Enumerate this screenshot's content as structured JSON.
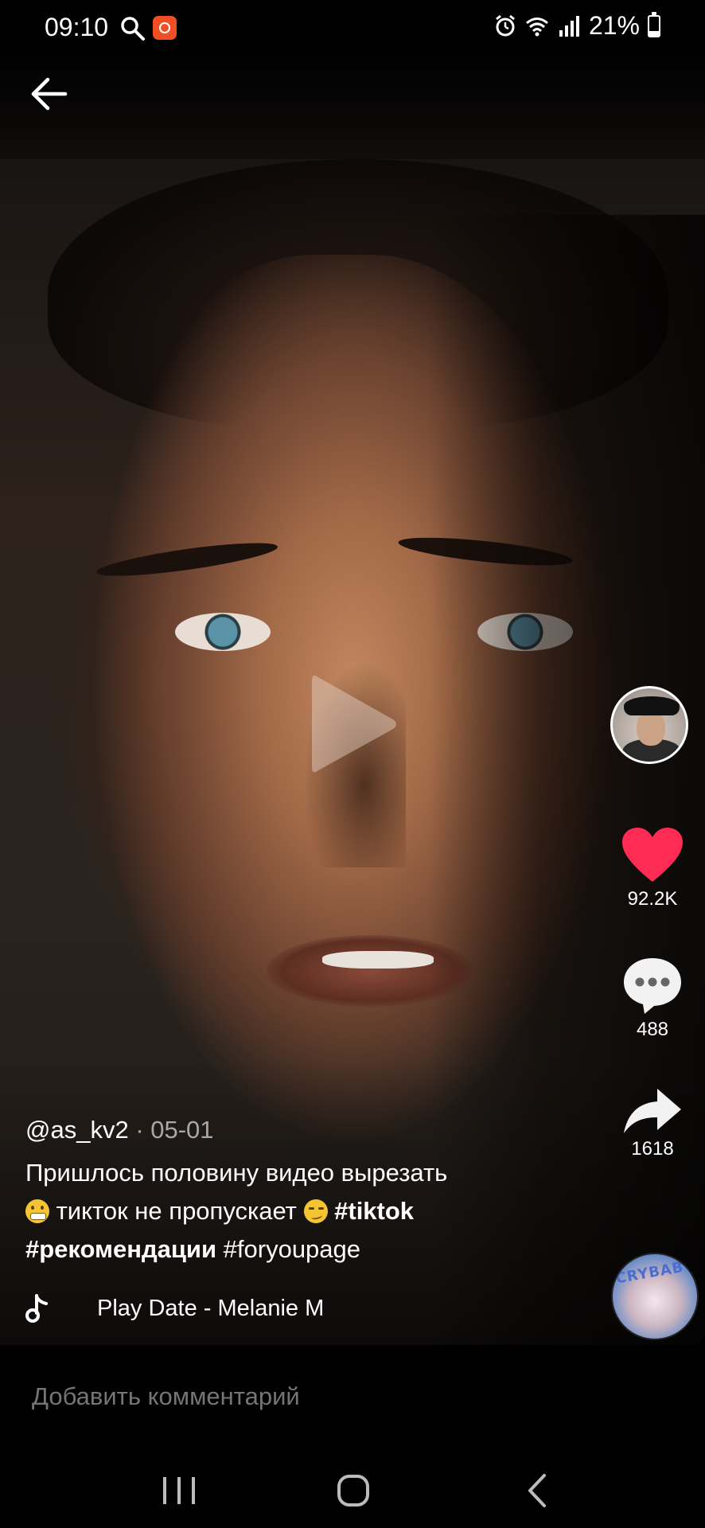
{
  "status_bar": {
    "time": "09:10",
    "battery_text": "21%",
    "battery_level": 0.21,
    "icons": [
      "search-icon",
      "app-notification-icon",
      "alarm-icon",
      "wifi-icon",
      "signal-icon",
      "battery-icon"
    ]
  },
  "video": {
    "author": "@as_kv2",
    "date": " · 05-01",
    "caption": {
      "line1": "Пришлось половину видео вырезать",
      "line2_text": " тикток не пропускает ",
      "hashtag_tiktok": "#tiktok",
      "hashtag_rec": "#рекомендации",
      "hashtag_fyp": " #foryoupage"
    },
    "music_title": "Play Date - Melanie M",
    "music_disc_label": "CRYBABY"
  },
  "actions": {
    "likes": "92.2K",
    "comments": "488",
    "shares": "1618"
  },
  "comment_bar": {
    "placeholder": "Добавить комментарий"
  },
  "colors": {
    "like_red": "#fe2c55",
    "icon_white": "#ffffff",
    "background": "#000000"
  }
}
